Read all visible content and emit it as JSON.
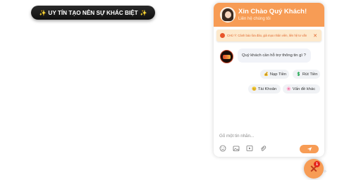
{
  "promo_badge": {
    "text": "UY TÍN TẠO NÊN SỰ KHÁC BIỆT"
  },
  "chat": {
    "header": {
      "title": "Xin Chào Quý Khách!",
      "subtitle": "Liên hệ chúng tôi"
    },
    "notice": {
      "text": "CHÚ Ý: Cảnh báo lừa đảo, giả mạo nhân viên, liên hệ tư vấn"
    },
    "bot_message": "Quý khách cần hỗ trợ thông tin gì ?",
    "quick_replies": [
      {
        "icon": "💰",
        "label": "Nạp Tiền"
      },
      {
        "icon": "💲",
        "label": "Rút Tiền"
      },
      {
        "icon": "😊",
        "label": "Tài Khoản"
      },
      {
        "icon": "🌸",
        "label": "Vấn đề khác"
      }
    ],
    "input": {
      "placeholder": "Gõ một tin nhắn..."
    },
    "unread_count": "1",
    "accent_color": "#f79c55"
  }
}
